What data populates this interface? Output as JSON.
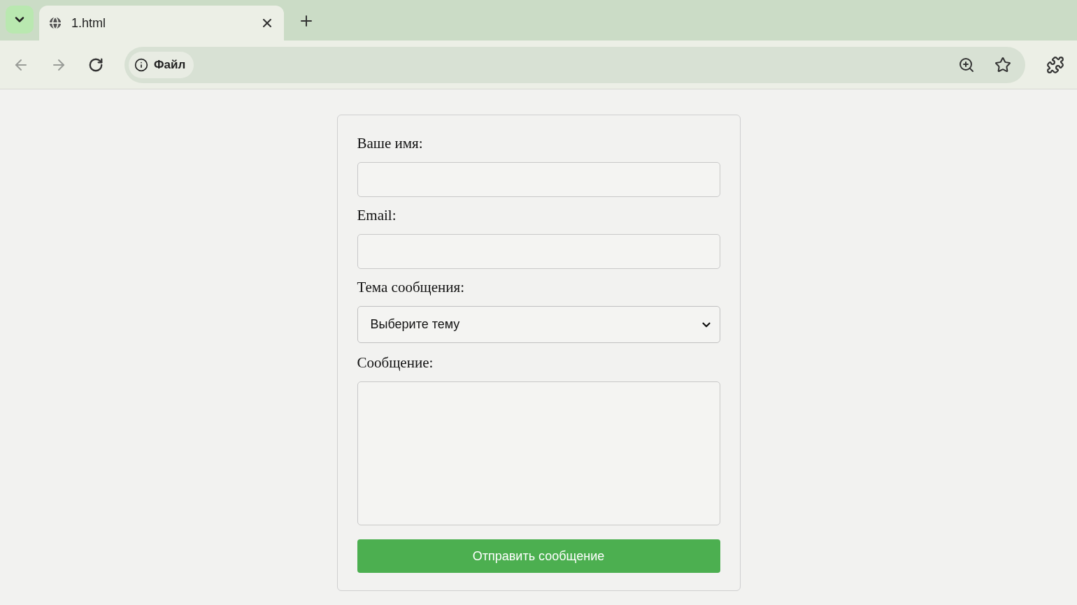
{
  "browser": {
    "tab": {
      "title": "1.html",
      "selected": true
    },
    "back_disabled": true,
    "forward_disabled": true,
    "address": {
      "label": "Файл"
    }
  },
  "form": {
    "fields": [
      {
        "kind": "input",
        "label": "Ваше имя:"
      },
      {
        "kind": "input",
        "label": "Email:"
      },
      {
        "kind": "select",
        "label": "Тема сообщения:",
        "value": "Выберите тему"
      },
      {
        "kind": "textarea",
        "label": "Сообщение:"
      }
    ],
    "submit": "Отправить сообщение"
  }
}
